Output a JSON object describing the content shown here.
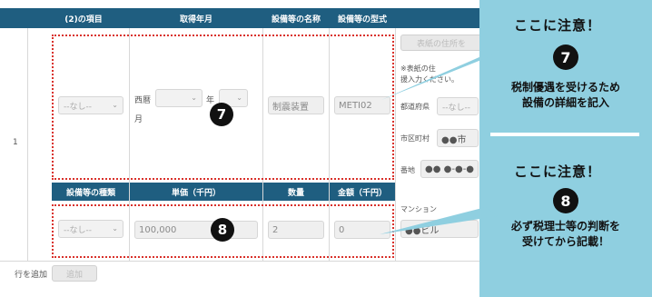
{
  "header_row1": {
    "item": "(2)の項目",
    "acquired": "取得年月",
    "equip_name": "設備等の名称",
    "equip_model": "設備等の型式"
  },
  "header_row2": {
    "equip_type": "設備等の種類",
    "unit_price": "単価（千円）",
    "quantity": "数量",
    "amount": "金額（千円）"
  },
  "row": {
    "index": "1",
    "item_select": "--なし--",
    "era_label": "西暦",
    "year_label": "年",
    "month_label": "月",
    "equip_name_value": "制震装置",
    "equip_model_value": "METI02",
    "equip_type_select": "--なし--",
    "unit_price_value": "100,000",
    "quantity_value": "2",
    "amount_value": "0"
  },
  "side_panel": {
    "button": "表紙の住所を",
    "note_line1": "※表紙の住",
    "note_line2": "援入力ください。",
    "prefecture_label": "都道府県",
    "prefecture_select": "--なし--",
    "city_label": "市区町村",
    "city_value": "●●市",
    "street_label": "番地",
    "street_value": "●● ●-●-●",
    "building_label": "マンション",
    "building_value": "●●ビル"
  },
  "footer": {
    "add_row_label": "行を追加",
    "add_button": "追加"
  },
  "markers": {
    "seven": "7",
    "eight": "8"
  },
  "callout_7": {
    "title": "ここに注意！",
    "number": "7",
    "line1": "税制優遇を受けるため",
    "line2": "設備の詳細を記入"
  },
  "callout_8": {
    "title": "ここに注意！",
    "number": "8",
    "line1": "必ず税理士等の判断を",
    "line2": "受けてから記載！"
  },
  "colors": {
    "header_bg": "#1f5e80",
    "background": "#8fcfe0",
    "dotted_border": "#d9312b"
  }
}
